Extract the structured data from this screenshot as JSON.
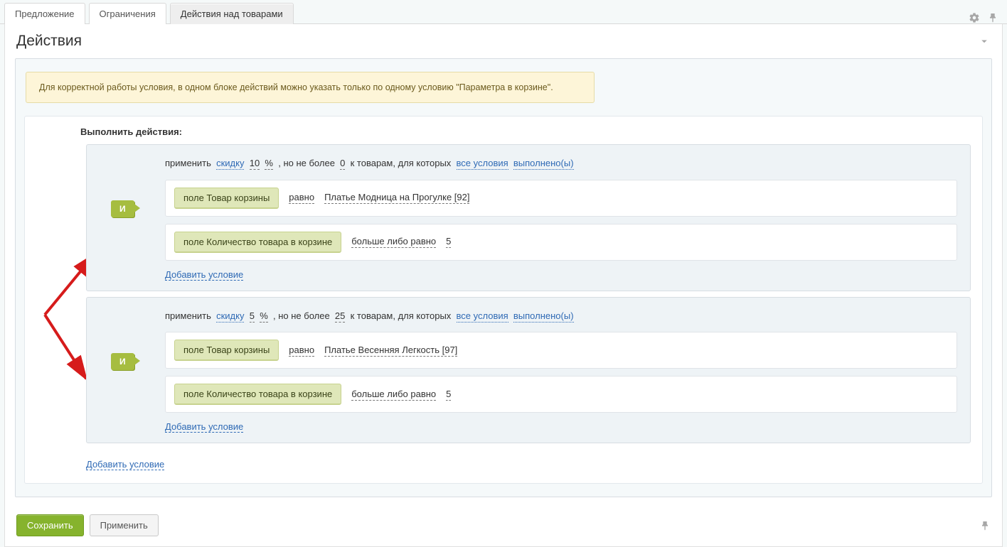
{
  "tabs": {
    "offer": "Предложение",
    "limits": "Ограничения",
    "actions": "Действия над товарами"
  },
  "panel": {
    "title": "Действия"
  },
  "notice": "Для корректной работы условия, в одном блоке действий можно указать только по одному условию \"Параметра в корзине\".",
  "rules_title": "Выполнить действия:",
  "words": {
    "apply": "применить",
    "discount": "скидку",
    "percent": "%",
    "but_not_more": ", но не более",
    "to_items": "к товарам, для которых",
    "all_conditions": "все условия",
    "fulfilled": "выполнено(ы)",
    "and": "И",
    "add_condition": "Добавить условие",
    "equal": "равно",
    "gte": "больше либо равно"
  },
  "actions": [
    {
      "discount_value": "10",
      "max_value": "0",
      "conditions": [
        {
          "field": "поле Товар корзины",
          "op": "равно",
          "value": "Платье Модница на Прогулке [92]"
        },
        {
          "field": "поле Количество товара в корзине",
          "op": "больше либо равно",
          "value": "5"
        }
      ]
    },
    {
      "discount_value": "5",
      "max_value": "25",
      "conditions": [
        {
          "field": "поле Товар корзины",
          "op": "равно",
          "value": "Платье Весенняя Легкость [97]"
        },
        {
          "field": "поле Количество товара в корзине",
          "op": "больше либо равно",
          "value": "5"
        }
      ]
    }
  ],
  "buttons": {
    "save": "Сохранить",
    "apply": "Применить"
  }
}
